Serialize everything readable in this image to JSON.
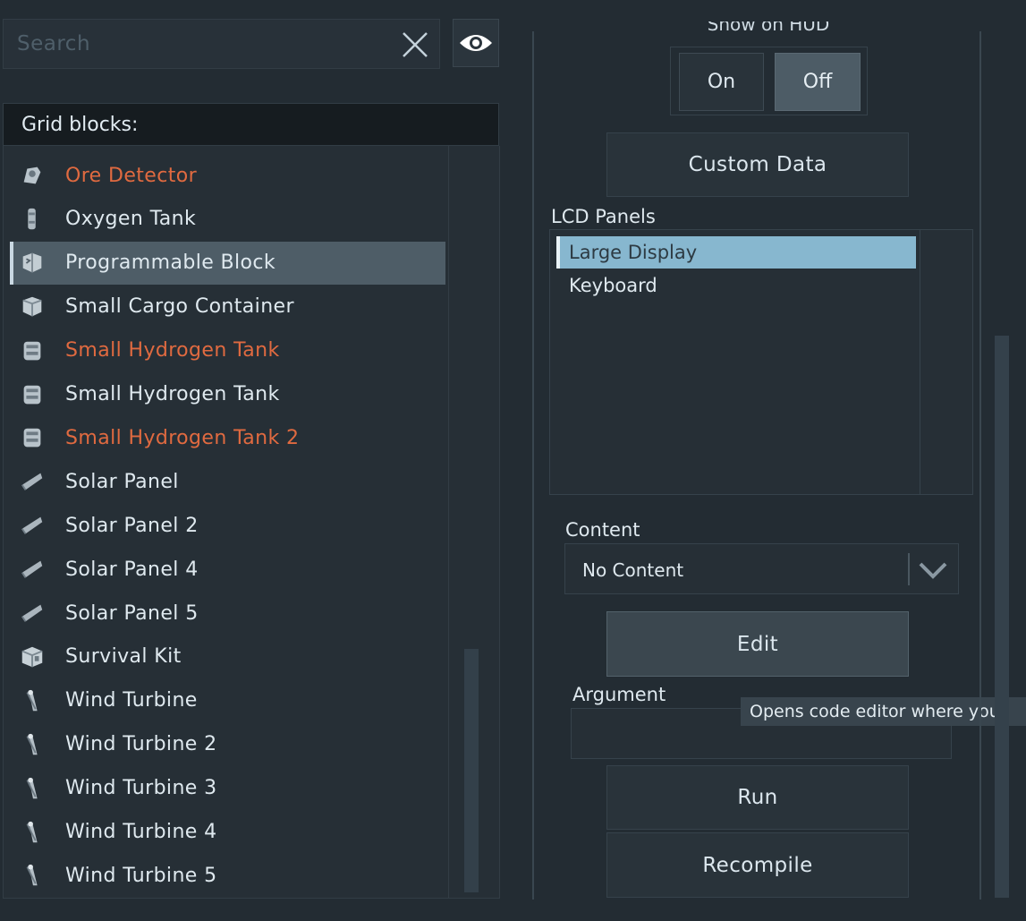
{
  "search": {
    "placeholder": "Search"
  },
  "icons": {
    "search_clear": "close-icon",
    "visibility": "eye-icon",
    "dropdown": "chevron-down-icon"
  },
  "grid_blocks": {
    "header": "Grid blocks:",
    "items": [
      {
        "label": "Ore Detector",
        "warn": true,
        "icon": "ore-detector-icon"
      },
      {
        "label": "Oxygen Tank",
        "warn": false,
        "icon": "oxygen-tank-icon"
      },
      {
        "label": "Programmable Block",
        "warn": false,
        "icon": "programmable-block-icon",
        "selected": true
      },
      {
        "label": "Small Cargo Container",
        "warn": false,
        "icon": "cargo-container-icon"
      },
      {
        "label": "Small Hydrogen Tank",
        "warn": true,
        "icon": "hydrogen-tank-icon"
      },
      {
        "label": "Small Hydrogen Tank",
        "warn": false,
        "icon": "hydrogen-tank-icon"
      },
      {
        "label": "Small Hydrogen Tank 2",
        "warn": true,
        "icon": "hydrogen-tank-icon"
      },
      {
        "label": "Solar Panel",
        "warn": false,
        "icon": "solar-panel-icon"
      },
      {
        "label": "Solar Panel 2",
        "warn": false,
        "icon": "solar-panel-icon"
      },
      {
        "label": "Solar Panel 4",
        "warn": false,
        "icon": "solar-panel-icon"
      },
      {
        "label": "Solar Panel 5",
        "warn": false,
        "icon": "solar-panel-icon"
      },
      {
        "label": "Survival Kit",
        "warn": false,
        "icon": "survival-kit-icon"
      },
      {
        "label": "Wind Turbine",
        "warn": false,
        "icon": "wind-turbine-icon"
      },
      {
        "label": "Wind Turbine 2",
        "warn": false,
        "icon": "wind-turbine-icon"
      },
      {
        "label": "Wind Turbine 3",
        "warn": false,
        "icon": "wind-turbine-icon"
      },
      {
        "label": "Wind Turbine 4",
        "warn": false,
        "icon": "wind-turbine-icon"
      },
      {
        "label": "Wind Turbine 5",
        "warn": false,
        "icon": "wind-turbine-icon"
      }
    ]
  },
  "hud": {
    "label": "Show on HUD",
    "on_label": "On",
    "off_label": "Off",
    "selected": "Off"
  },
  "custom_data_label": "Custom Data",
  "lcd": {
    "label": "LCD Panels",
    "items": [
      {
        "label": "Large Display",
        "selected": true
      },
      {
        "label": "Keyboard",
        "selected": false
      }
    ]
  },
  "content": {
    "label": "Content",
    "value": "No Content"
  },
  "edit_label": "Edit",
  "argument": {
    "label": "Argument",
    "value": ""
  },
  "tooltip": "Opens code editor where you",
  "run_label": "Run",
  "recompile_label": "Recompile",
  "colors": {
    "background": "#232c33",
    "warning_text": "#e06a40",
    "selection": "#87b7cf",
    "selected_row": "#4e5d67"
  }
}
